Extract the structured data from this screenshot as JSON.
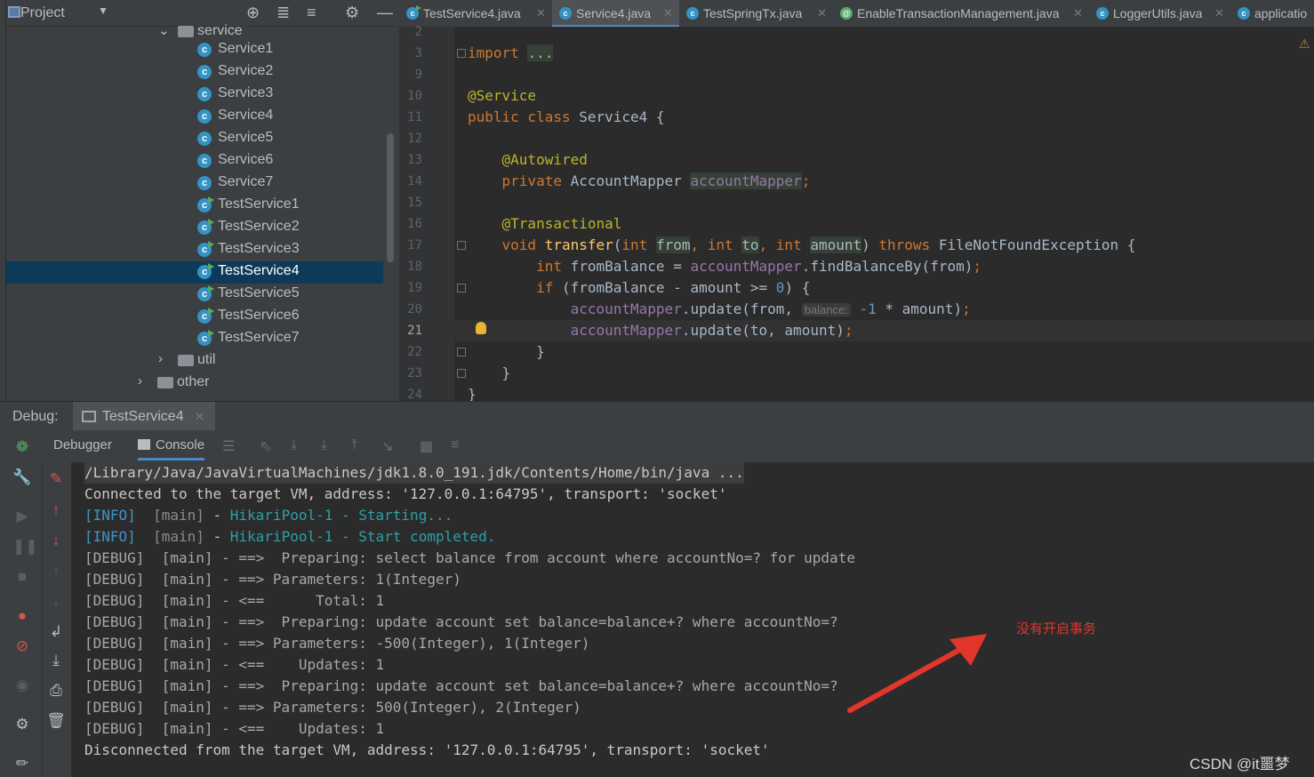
{
  "project": {
    "title": "Project",
    "tree": [
      {
        "type": "folder",
        "label": "service",
        "open": true
      },
      {
        "type": "class",
        "label": "Service1",
        "runnable": false
      },
      {
        "type": "class",
        "label": "Service2",
        "runnable": false
      },
      {
        "type": "class",
        "label": "Service3",
        "runnable": false
      },
      {
        "type": "class",
        "label": "Service4",
        "runnable": false
      },
      {
        "type": "class",
        "label": "Service5",
        "runnable": false
      },
      {
        "type": "class",
        "label": "Service6",
        "runnable": false
      },
      {
        "type": "class",
        "label": "Service7",
        "runnable": false
      },
      {
        "type": "class",
        "label": "TestService1",
        "runnable": true
      },
      {
        "type": "class",
        "label": "TestService2",
        "runnable": true
      },
      {
        "type": "class",
        "label": "TestService3",
        "runnable": true
      },
      {
        "type": "class",
        "label": "TestService4",
        "runnable": true,
        "selected": true
      },
      {
        "type": "class",
        "label": "TestService5",
        "runnable": true
      },
      {
        "type": "class",
        "label": "TestService6",
        "runnable": true
      },
      {
        "type": "class",
        "label": "TestService7",
        "runnable": true
      },
      {
        "type": "folder",
        "label": "util",
        "open": false
      },
      {
        "type": "folder",
        "label": "other",
        "open": false
      }
    ]
  },
  "editor": {
    "tabs": [
      {
        "label": "TestService4.java",
        "icon": "class-run-icon",
        "active": false
      },
      {
        "label": "Service4.java",
        "icon": "class-icon",
        "active": true
      },
      {
        "label": "TestSpringTx.java",
        "icon": "class-icon",
        "active": false
      },
      {
        "label": "EnableTransactionManagement.java",
        "icon": "annotation-icon",
        "active": false
      },
      {
        "label": "LoggerUtils.java",
        "icon": "class-icon",
        "active": false
      },
      {
        "label": "applicatio",
        "icon": "config-icon",
        "active": false
      }
    ],
    "line_numbers": [
      "2",
      "3",
      "9",
      "10",
      "11",
      "12",
      "13",
      "14",
      "15",
      "16",
      "17",
      "18",
      "19",
      "20",
      "21",
      "22",
      "23",
      "24"
    ],
    "current_line": "21",
    "code": {
      "l3_import": "import",
      "l3_ellipsis": "...",
      "l10": "@Service",
      "l11_kw": "public class ",
      "l11_name": "Service4",
      "l11_brace": " {",
      "l13": "@Autowired",
      "l14_kw": "private ",
      "l14_type": "AccountMapper ",
      "l14_field": "accountMapper",
      "l14_semi": ";",
      "l16": "@Transactional",
      "l17_void": "void ",
      "l17_fn": "transfer",
      "l17_p1": "(",
      "l17_int1": "int ",
      "l17_from": "from",
      "l17_c1": ", ",
      "l17_int2": "int ",
      "l17_to": "to",
      "l17_c2": ", ",
      "l17_int3": "int ",
      "l17_amount": "amount",
      "l17_p2": ") ",
      "l17_throws": "throws ",
      "l17_ex": "FileNotFoundException {",
      "l18_int": "int ",
      "l18_var": "fromBalance = ",
      "l18_field": "accountMapper",
      "l18_call": ".findBalanceBy(from)",
      "l18_semi": ";",
      "l19_if": "if ",
      "l19_cond": "(fromBalance - amount >= ",
      "l19_num": "0",
      "l19_end": ") {",
      "l20_field": "accountMapper",
      "l20_call": ".update(from, ",
      "l20_hint": "balance:",
      "l20_neg": " -1",
      "l20_rest": " * amount)",
      "l20_semi": ";",
      "l21_field": "accountMapper",
      "l21_call": ".update(to, amount)",
      "l21_semi": ";",
      "l22": "}",
      "l23": "}",
      "l24": "}"
    }
  },
  "debug": {
    "label": "Debug:",
    "tab": "TestService4",
    "subtabs": [
      "Debugger",
      "Console"
    ],
    "active_subtab": "Console",
    "console": [
      {
        "kind": "cmd",
        "text": "/Library/Java/JavaVirtualMachines/jdk1.8.0_191.jdk/Contents/Home/bin/java ..."
      },
      {
        "kind": "plain",
        "text": "Connected to the target VM, address: '127.0.0.1:64795', transport: 'socket'"
      },
      {
        "kind": "info",
        "level": "[INFO]",
        "thread": "[main]",
        "sep": " - ",
        "msg": "HikariPool-1 - Starting..."
      },
      {
        "kind": "info",
        "level": "[INFO]",
        "thread": "[main]",
        "sep": " - ",
        "msg": "HikariPool-1 - Start completed."
      },
      {
        "kind": "debug",
        "text": "[DEBUG]  [main] - ==>  Preparing: select balance from account where accountNo=? for update"
      },
      {
        "kind": "debug",
        "text": "[DEBUG]  [main] - ==> Parameters: 1(Integer)"
      },
      {
        "kind": "debug",
        "text": "[DEBUG]  [main] - <==      Total: 1"
      },
      {
        "kind": "debug",
        "text": "[DEBUG]  [main] - ==>  Preparing: update account set balance=balance+? where accountNo=?"
      },
      {
        "kind": "debug",
        "text": "[DEBUG]  [main] - ==> Parameters: -500(Integer), 1(Integer)"
      },
      {
        "kind": "debug",
        "text": "[DEBUG]  [main] - <==    Updates: 1"
      },
      {
        "kind": "debug",
        "text": "[DEBUG]  [main] - ==>  Preparing: update account set balance=balance+? where accountNo=?"
      },
      {
        "kind": "debug",
        "text": "[DEBUG]  [main] - ==> Parameters: 500(Integer), 2(Integer)"
      },
      {
        "kind": "debug",
        "text": "[DEBUG]  [main] - <==    Updates: 1"
      },
      {
        "kind": "plain",
        "text": "Disconnected from the target VM, address: '127.0.0.1:64795', transport: 'socket'"
      }
    ]
  },
  "annotation": {
    "text": "没有开启事务",
    "color": "#e2362d"
  },
  "watermark": "CSDN @it噩梦",
  "colors": {
    "selection": "#0d3a58",
    "accent": "#4a88c7",
    "keyword": "#cc7832",
    "annotation": "#bbb529",
    "field": "#9876aa",
    "function": "#ffc66d",
    "info": "#3e95c9"
  }
}
